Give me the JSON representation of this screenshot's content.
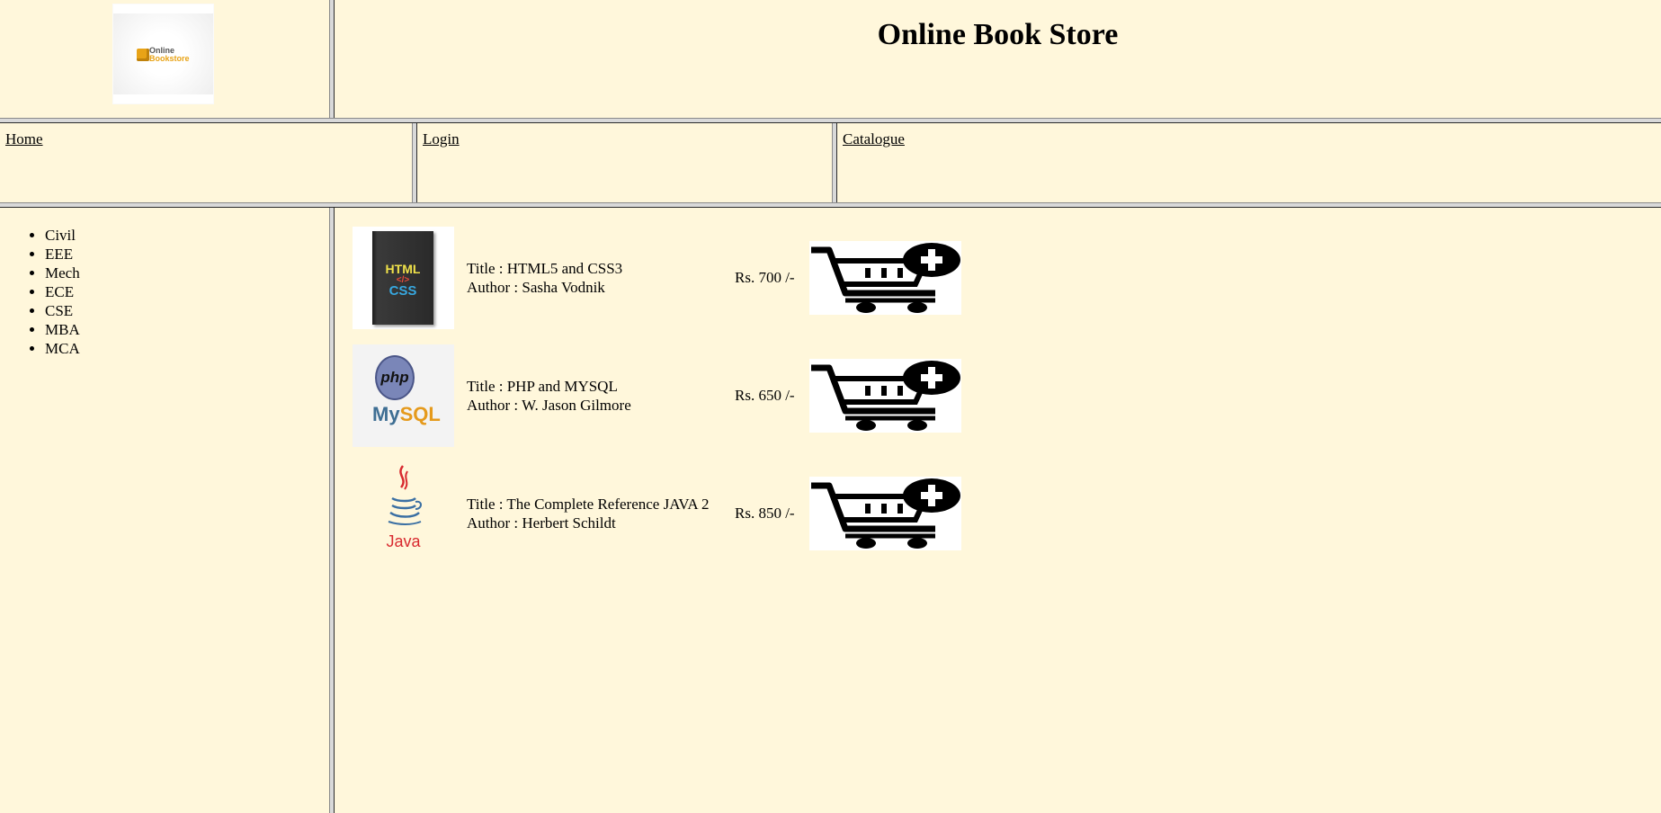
{
  "header": {
    "logo": {
      "line1": "Online",
      "line2": "Bookstore",
      "icon": "box-icon"
    },
    "title": "Online Book Store"
  },
  "nav": {
    "home": "Home",
    "login": "Login",
    "catalogue": "Catalogue"
  },
  "sidebar": {
    "categories": [
      "Civil",
      "EEE",
      "Mech",
      "ECE",
      "CSE",
      "MBA",
      "MCA"
    ]
  },
  "books": [
    {
      "cover": "html-css-book-cover",
      "cover_text": [
        "HTML",
        "</>",
        "CSS"
      ],
      "title": "Title : HTML5 and CSS3",
      "author": "Author : Sasha Vodnik",
      "price": "Rs. 700 /-"
    },
    {
      "cover": "php-mysql-logo",
      "cover_text": [
        "php",
        "My",
        "SQL"
      ],
      "title": "Title : PHP and MYSQL",
      "author": "Author : W. Jason Gilmore",
      "price": "Rs. 650 /-"
    },
    {
      "cover": "java-logo",
      "cover_text": [
        "Java"
      ],
      "title": "Title : The Complete Reference JAVA 2",
      "author": "Author : Herbert Schildt",
      "price": "Rs. 850 /-"
    }
  ],
  "icons": {
    "cart": "add-to-cart-icon"
  },
  "colors": {
    "background": "#fff7db",
    "frame_border": "#d9d9d9"
  }
}
